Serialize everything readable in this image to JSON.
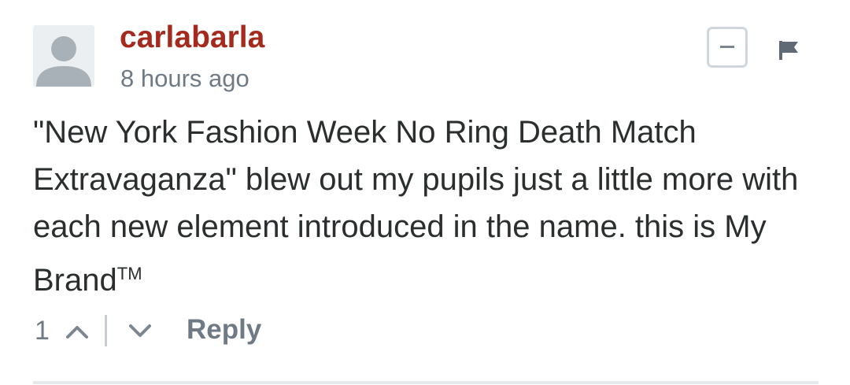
{
  "comment": {
    "author": "carlabarla",
    "timestamp": "8 hours ago",
    "message_text": "\"New York Fashion Week No Ring Death Match Extravaganza\" blew out my pupils just a little more with each new element introduced in the name. this is My Brand",
    "message_trademark": "TM",
    "vote_count": "1",
    "reply_label": "Reply",
    "avatar_icon": "user-avatar-icon",
    "collapse_icon": "minus-icon",
    "flag_icon": "flag-icon",
    "upvote_icon": "chevron-up-icon",
    "downvote_icon": "chevron-down-icon"
  },
  "colors": {
    "author": "#a52a1e",
    "muted": "#6f7a85",
    "text": "#2a2e2e",
    "border": "#cfd5da"
  }
}
